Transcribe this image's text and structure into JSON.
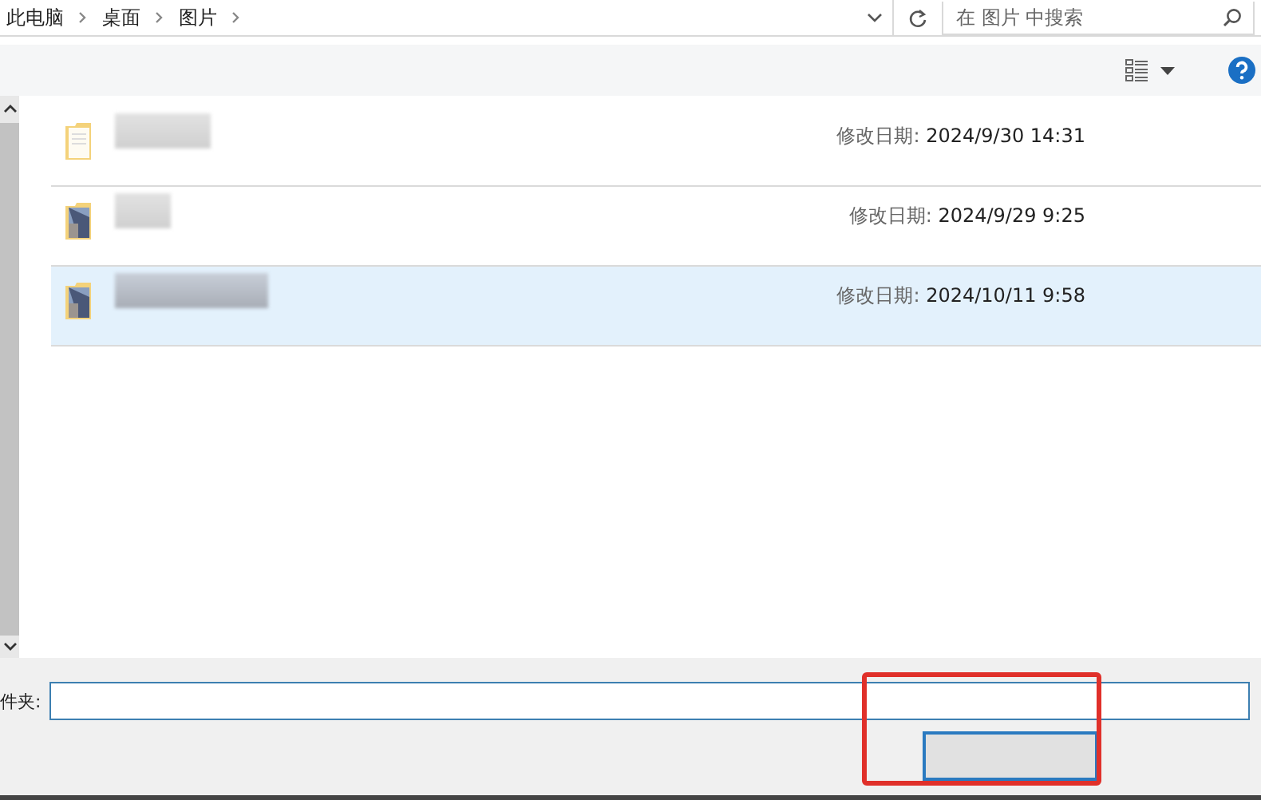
{
  "breadcrumb": [
    "此电脑",
    "桌面",
    "图片"
  ],
  "search": {
    "placeholder": "在 图片 中搜索"
  },
  "files": [
    {
      "kind": "plain",
      "date_label": "修改日期:",
      "date": "2024/9/30 14:31",
      "selected": false
    },
    {
      "kind": "photo",
      "date_label": "修改日期:",
      "date": "2024/9/29 9:25",
      "selected": false
    },
    {
      "kind": "photo",
      "date_label": "修改日期:",
      "date": "2024/10/11 9:58",
      "selected": true
    }
  ],
  "folder_field": {
    "label": "件夹:"
  },
  "highlight": {
    "color": "#e0302a"
  }
}
